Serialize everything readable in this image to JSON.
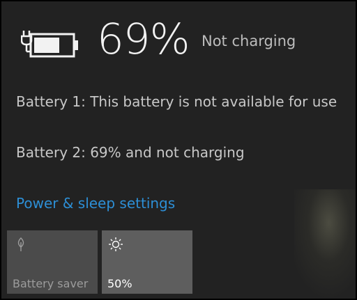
{
  "battery": {
    "icon": "battery-charging-plug-icon",
    "percent": "69%",
    "status": "Not charging",
    "charge_level": 0.69
  },
  "details": {
    "battery1": "Battery 1: This battery is not available for use",
    "battery2": "Battery 2: 69% and not charging"
  },
  "link": {
    "label": "Power & sleep settings",
    "color": "#2d8fd6"
  },
  "tiles": [
    {
      "icon": "battery-saver-icon",
      "label": "Battery saver"
    },
    {
      "icon": "brightness-icon",
      "label": "50%"
    }
  ],
  "colors": {
    "background": "#222222",
    "text": "#c8c8c8",
    "accent": "#2d8fd6"
  }
}
